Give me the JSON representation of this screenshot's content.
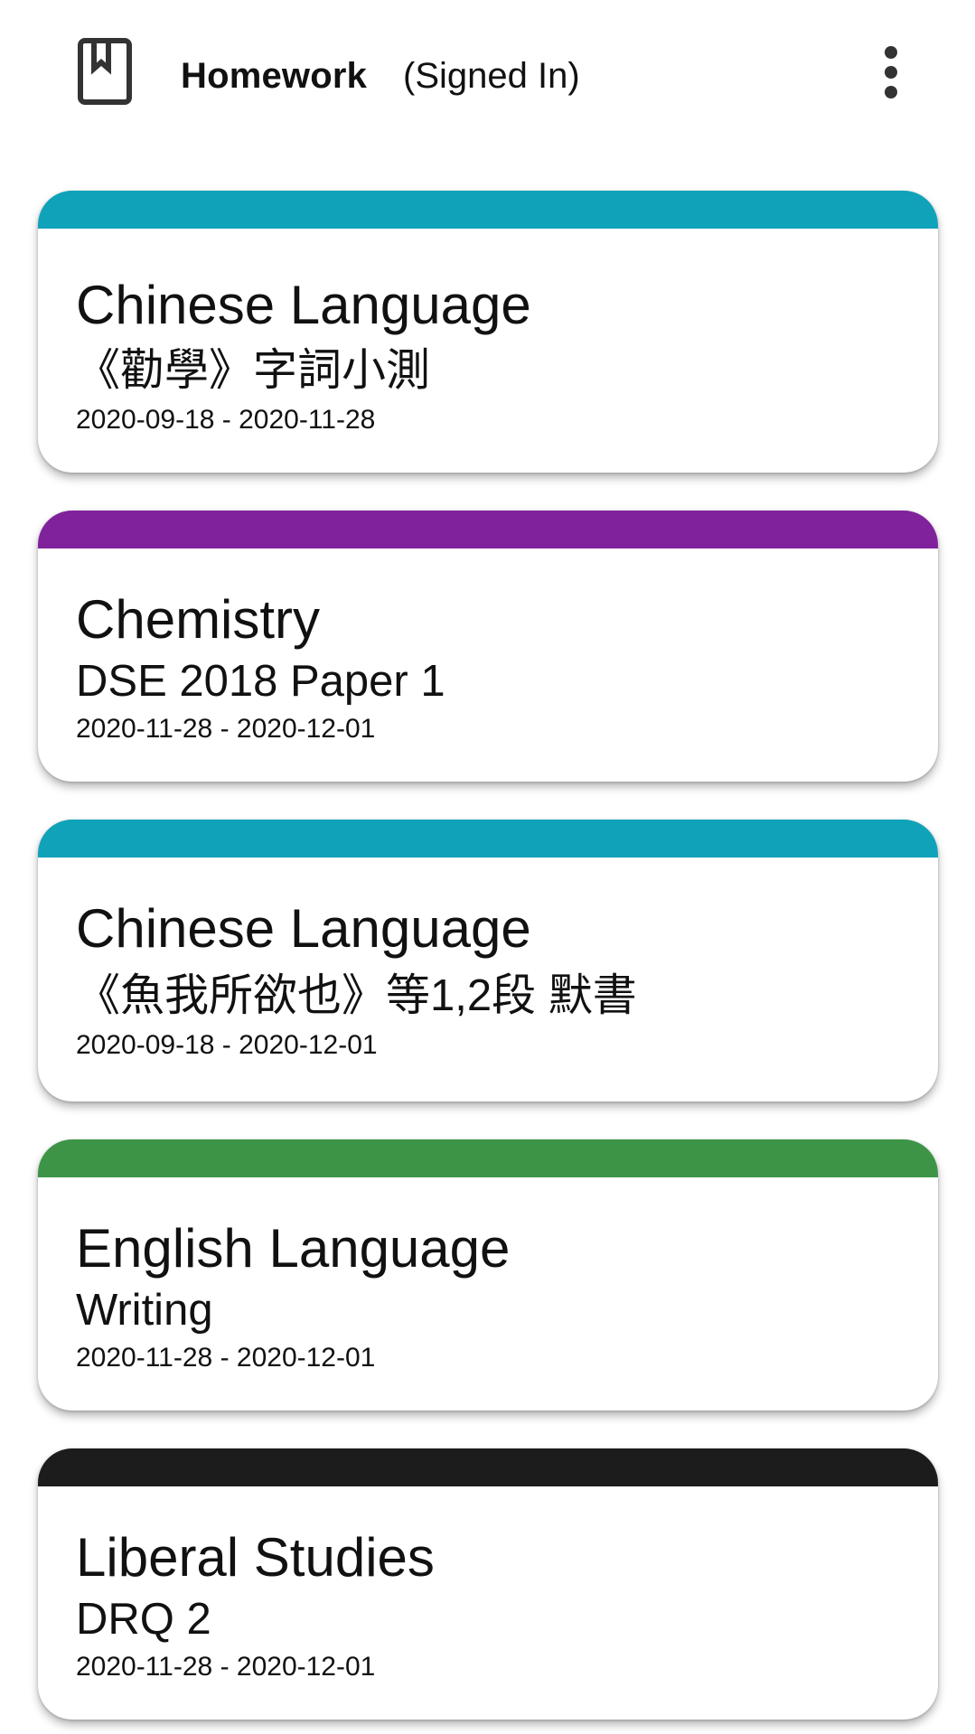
{
  "appbar": {
    "icon": "bookmark-book-icon",
    "title": "Homework",
    "status": "(Signed In)",
    "overflow_icon": "more-vert-icon"
  },
  "homework": [
    {
      "subject": "Chinese Language",
      "title": "《勸學》字詞小測",
      "dates": "2020-09-18 - 2020-11-28",
      "color": "#10A2B8"
    },
    {
      "subject": "Chemistry",
      "title": "DSE 2018 Paper 1",
      "dates": "2020-11-28 - 2020-12-01",
      "color": "#80229B"
    },
    {
      "subject": "Chinese Language",
      "title": "《魚我所欲也》等1,2段 默書",
      "dates": "2020-09-18 - 2020-12-01",
      "color": "#10A2B8"
    },
    {
      "subject": "English Language",
      "title": "Writing",
      "dates": "2020-11-28 - 2020-12-01",
      "color": "#3D9446"
    },
    {
      "subject": "Liberal Studies",
      "title": "DRQ 2",
      "dates": "2020-11-28 - 2020-12-01",
      "color": "#1C1C1C"
    }
  ]
}
